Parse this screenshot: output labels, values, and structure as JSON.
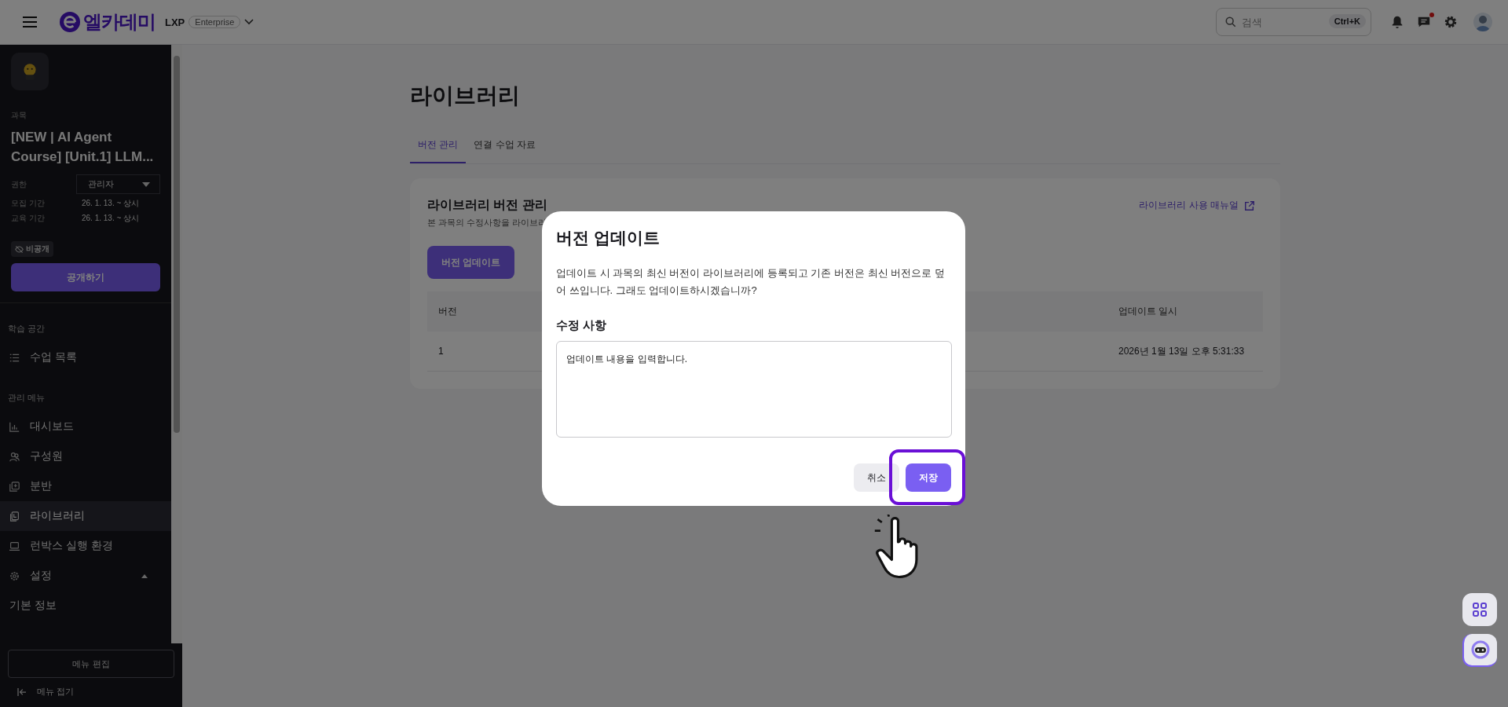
{
  "top_bar": {
    "logo": "엘카데미",
    "product": "LXP",
    "edition": "Enterprise",
    "search": {
      "placeholder": "검색",
      "shortcut": "Ctrl+K"
    },
    "messages_unread": true
  },
  "sidebar": {
    "course_label": "과목",
    "course_title": "[NEW | AI Agent Course] [Unit.1] LLM...",
    "fields": [
      {
        "label": "권한",
        "value": "관리자",
        "kind": "dropdown"
      },
      {
        "label": "모집 기간",
        "value": "26. 1. 13. ~ 상시",
        "kind": "text"
      },
      {
        "label": "교육 기간",
        "value": "26. 1. 13. ~ 상시",
        "kind": "text"
      }
    ],
    "visibility_badge": "비공개",
    "publish_button": "공개하기",
    "sections": [
      {
        "title": "학습 공간",
        "items": [
          {
            "label": "수업 목록",
            "selected": false
          }
        ]
      },
      {
        "title": "관리 메뉴",
        "items": [
          {
            "label": "대시보드",
            "selected": false
          },
          {
            "label": "구성원",
            "selected": false
          },
          {
            "label": "분반",
            "selected": false
          },
          {
            "label": "라이브러리",
            "selected": true
          },
          {
            "label": "런박스 실행 환경",
            "selected": false
          },
          {
            "label": "설정",
            "selected": false,
            "expanded": true,
            "children": [
              {
                "label": "기본 정보",
                "selected": false
              }
            ]
          }
        ]
      }
    ],
    "edit_menu_button": "메뉴 편집",
    "collapse_menu": "메뉴 접기"
  },
  "main": {
    "page_title": "라이브러리",
    "tabs": [
      {
        "label": "버전 관리",
        "selected": true
      },
      {
        "label": "연결 수업 자료",
        "selected": false
      }
    ],
    "card": {
      "title": "라이브러리 버전 관리",
      "description": "본 과목의 수정사항을 라이브러",
      "manual_link": "라이브러리 사용 매뉴얼",
      "update_button": "버전 업데이트",
      "table": {
        "columns": [
          "버전",
          "업데이트 일시"
        ],
        "rows": [
          [
            "1",
            "2026년 1월 13일 오후 5:31:33"
          ]
        ]
      }
    }
  },
  "dialog": {
    "title": "버전 업데이트",
    "message": "업데이트 시 과목의 최신 버전이 라이브러리에 등록되고 기존 버전은 최신 버전으로 덮어 쓰입니다. 그래도 업데이트하시겠습니까?",
    "field_label": "수정 사항",
    "field_value": "업데이트 내용을 입력합니다.",
    "buttons": [
      {
        "label": "취소",
        "kind": "secondary",
        "highlighted": false
      },
      {
        "label": "저장",
        "kind": "primary",
        "highlighted": true
      }
    ]
  }
}
